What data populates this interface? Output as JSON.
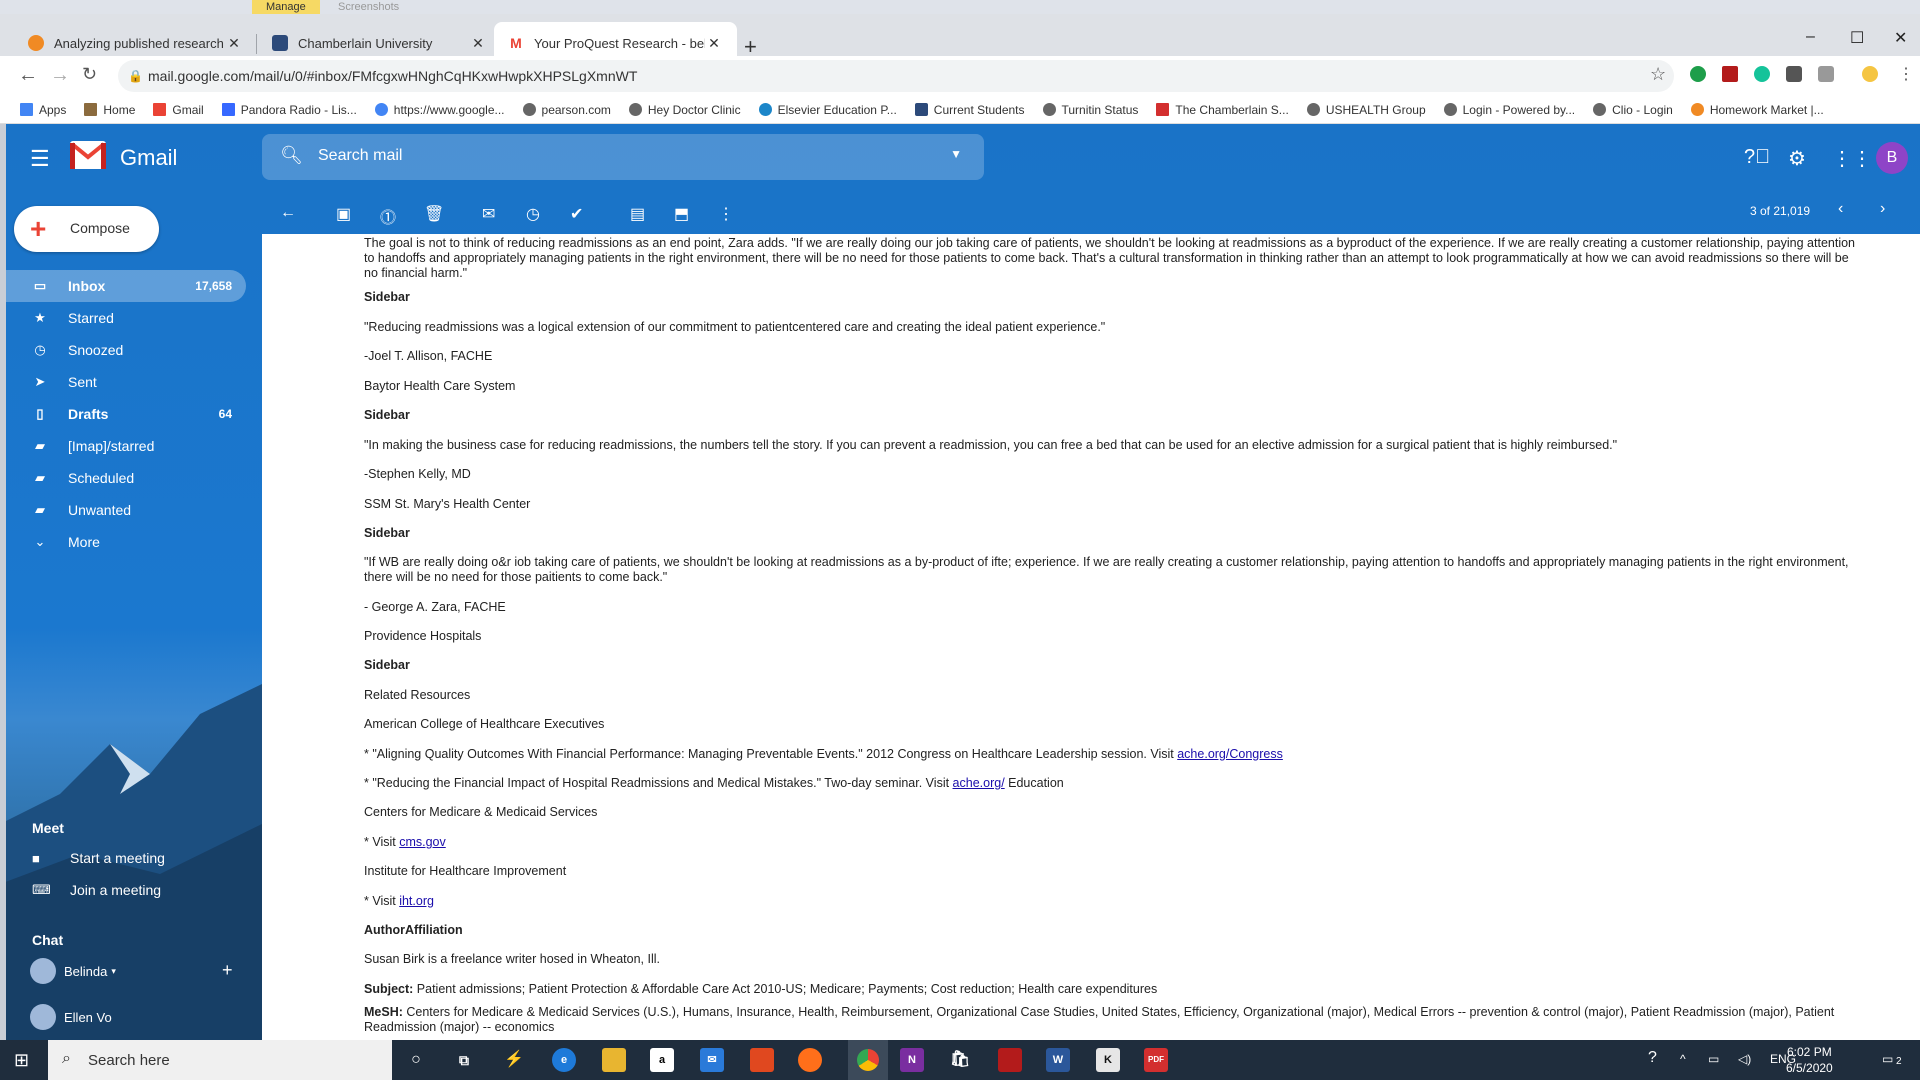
{
  "taskbar_top": {
    "manage": "Manage",
    "screenshots": "Screenshots"
  },
  "tabs": [
    {
      "title": "Analyzing published research | N",
      "favicon_color": "#f08a24"
    },
    {
      "title": "Chamberlain University",
      "favicon_color": "#2c4a7a"
    },
    {
      "title": "Your ProQuest Research - belper",
      "favicon_color": "#ea4335"
    }
  ],
  "url": "mail.google.com/mail/u/0/#inbox/FMfcgxwHNghCqHKxwHwpkXHPSLgXmnWT",
  "bookmarks": [
    "Apps",
    "Home",
    "Gmail",
    "Pandora Radio - Lis...",
    "https://www.google...",
    "pearson.com",
    "Hey Doctor Clinic",
    "Elsevier Education P...",
    "Current Students",
    "Turnitin Status",
    "The Chamberlain S...",
    "USHEALTH Group",
    "Login - Powered by...",
    "Clio - Login",
    "Homework Market |..."
  ],
  "gmail": {
    "brand": "Gmail",
    "search_placeholder": "Search mail",
    "avatar_letter": "B",
    "pager": "3 of 21,019",
    "compose": "Compose",
    "nav": [
      {
        "label": "Inbox",
        "count": "17,658",
        "icon": "inbox-icon",
        "active": true
      },
      {
        "label": "Starred",
        "count": "",
        "icon": "star-icon"
      },
      {
        "label": "Snoozed",
        "count": "",
        "icon": "clock-icon"
      },
      {
        "label": "Sent",
        "count": "",
        "icon": "send-icon"
      },
      {
        "label": "Drafts",
        "count": "64",
        "icon": "draft-icon"
      },
      {
        "label": "[Imap]/starred",
        "count": "",
        "icon": "label-icon"
      },
      {
        "label": "Scheduled",
        "count": "",
        "icon": "label-icon"
      },
      {
        "label": "Unwanted",
        "count": "",
        "icon": "label-icon"
      },
      {
        "label": "More",
        "count": "",
        "icon": "chevron-down-icon"
      }
    ],
    "meet": {
      "heading": "Meet",
      "start": "Start a meeting",
      "join": "Join a meeting"
    },
    "chat": {
      "heading": "Chat",
      "user1": "Belinda",
      "user2": "Ellen Vo"
    }
  },
  "email": {
    "p1": "The goal is not to think of reducing readmissions as an end point, Zara adds. \"If we are really doing our job taking care of patients, we shouldn't be looking at readmissions as a byproduct of the experience. If we are really creating a customer relationship, paying attention to handoffs and appropriately managing patients in the right environment, there will be no need for those patients to come back. That's a cultural transformation in thinking rather than an attempt to look programmatically at how we can avoid readmissions so there will be no financial harm.\"",
    "sidebar": "Sidebar",
    "q1": "\"Reducing readmissions was a logical extension of our commitment to patientcentered care and creating the ideal patient experience.\"",
    "a1": "-Joel T. Allison, FACHE",
    "o1": "Baytor Health Care System",
    "q2": "\"In making the business case for reducing readmissions, the numbers tell the story. If you can prevent a readmission, you can free a bed that can be used for an elective admission for a surgical patient that is highly reimbursed.\"",
    "a2": "-Stephen Kelly, MD",
    "o2": "SSM St. Mary's Health Center",
    "q3": "\"If WB are really doing o&r iob taking care of patients, we shouldn't be looking at readmissions as a by-product of ifte; experience. If we are really creating a customer relationship, paying attention to handoffs and appropriately managing patients in the right environment, there will be no need for those paitients to come back.\"",
    "a3": "- George A. Zara, FACHE",
    "o3": "Providence Hospitals",
    "related": "Related Resources",
    "ache": "American College of Healthcare Executives",
    "r1_text": "* \"Aligning Quality Outcomes With Financial Performance: Managing Preventable Events.\" 2012 Congress on Healthcare Leadership session. Visit ",
    "r1_link": "ache.org/Congress",
    "r2_text": "* \"Reducing the Financial Impact of Hospital Readmissions and Medical Mistakes.\" Two-day seminar. Visit ",
    "r2_link": "ache.org/",
    "r2_tail": " Education",
    "cms": "Centers for Medicare & Medicaid Services",
    "visit": "* Visit ",
    "cms_link": "cms.gov",
    "ihi": "Institute for Healthcare Improvement",
    "ihi_link": "iht.org",
    "author_h": "AuthorAffiliation",
    "author": "Susan Birk is a freelance writer hosed in Wheaton, Ill.",
    "subject_h": "Subject:",
    "subject": " Patient admissions; Patient Protection & Affordable Care Act 2010-US; Medicare; Payments; Cost reduction; Health care expenditures",
    "mesh_h": "MeSH:",
    "mesh": " Centers for Medicare & Medicaid Services (U.S.), Humans, Insurance, Health, Reimbursement, Organizational Case Studies, United States, Efficiency, Organizational (major), Medical Errors -- prevention & control (major), Patient Readmission (major), Patient Readmission (major) -- economics"
  },
  "taskbar": {
    "search": "Search here",
    "lang": "ENG",
    "time": "6:02 PM",
    "date": "6/5/2020",
    "notifications": "2"
  }
}
